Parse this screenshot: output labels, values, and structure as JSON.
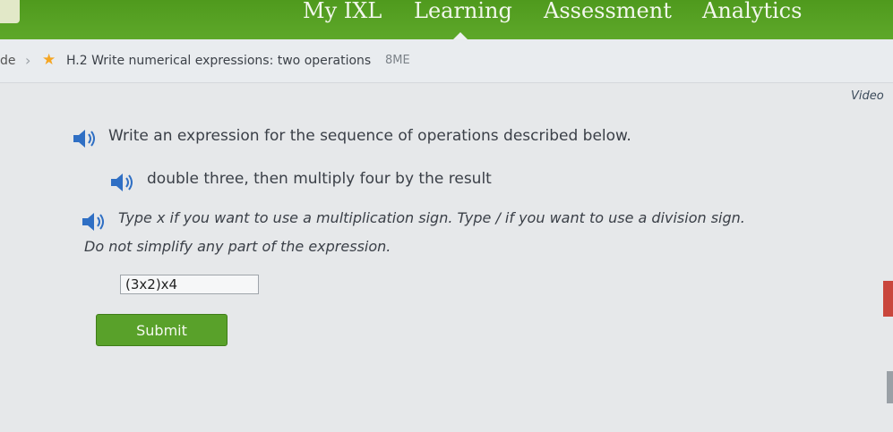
{
  "nav": {
    "items": [
      "My IXL",
      "Learning",
      "Assessment",
      "Analytics"
    ]
  },
  "breadcrumb": {
    "grade": "de",
    "skill_title": "H.2 Write numerical expressions: two operations",
    "skill_code": "8ME"
  },
  "video_link": "Video",
  "question": {
    "prompt": "Write an expression for the sequence of operations described below.",
    "description": "double three, then multiply four by the result",
    "instruction_line1": "Type x if you want to use a multiplication sign. Type / if you want to use a division sign.",
    "instruction_line2": "Do not simplify any part of the expression.",
    "answer_value": "(3x2)x4",
    "submit_label": "Submit"
  },
  "colors": {
    "nav_green": "#5ea82a",
    "submit_green": "#59a12a",
    "star": "#f5a623",
    "speaker_blue": "#2f6fc4"
  },
  "icons": [
    "speaker-icon",
    "star-icon",
    "chevron-right-icon"
  ]
}
